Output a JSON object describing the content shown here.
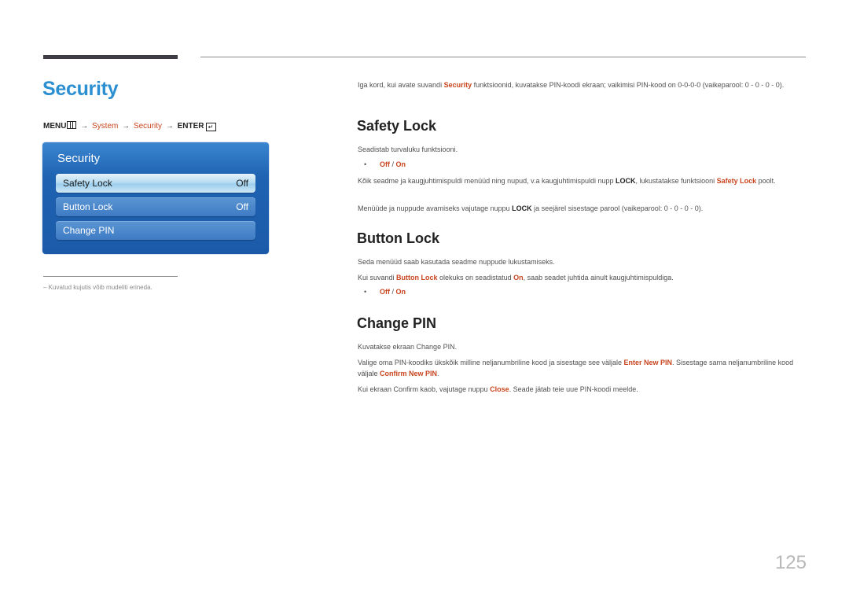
{
  "page": {
    "title": "Security",
    "page_number": "125",
    "footnote": "–  Kuvatud kujutis võib mudeliti erineda."
  },
  "menu_path": {
    "menu": "MENU",
    "arrow": "→",
    "system": "System",
    "security": "Security",
    "enter": "ENTER",
    "enter_glyph": "↵"
  },
  "osd": {
    "title": "Security",
    "items": [
      {
        "label": "Safety Lock",
        "value": "Off",
        "selected": true
      },
      {
        "label": "Button Lock",
        "value": "Off",
        "selected": false
      },
      {
        "label": "Change PIN",
        "value": "",
        "selected": false
      }
    ]
  },
  "intro": {
    "t1": "Iga kord, kui avate suvandi ",
    "hl1": "Security",
    "t2": " funktsioonid, kuvatakse PIN-koodi ekraan; vaikimisi PIN-kood on 0-0-0-0 (vaikeparool: 0 - 0 - 0 - 0)."
  },
  "sections": {
    "safety_lock": {
      "heading": "Safety Lock",
      "desc": "Seadistab turvaluku funktsiooni.",
      "option_off": "Off",
      "option_sep": " / ",
      "option_on": "On",
      "p1_t1": "Kõik seadme ja kaugjuhtimispuldi menüüd ning nupud, v.a kaugjuhtimispuldi nupp ",
      "p1_b1": "LOCK",
      "p1_t2": ", lukustatakse funktsiooni ",
      "p1_hl1": "Safety Lock",
      "p1_t3": " poolt.",
      "p2_t1": "Menüüde ja nuppude avamiseks vajutage nuppu ",
      "p2_b1": "LOCK",
      "p2_t2": " ja seejärel sisestage parool (vaikeparool: 0 - 0 - 0 - 0)."
    },
    "button_lock": {
      "heading": "Button Lock",
      "desc": "Seda menüüd saab kasutada seadme nuppude lukustamiseks.",
      "p1_t1": "Kui suvandi ",
      "p1_hl1": "Button Lock",
      "p1_t2": " olekuks on seadistatud ",
      "p1_hl2": "On",
      "p1_t3": ", saab seadet juhtida ainult kaugjuhtimispuldiga.",
      "option_off": "Off",
      "option_sep": " / ",
      "option_on": "On"
    },
    "change_pin": {
      "heading": "Change PIN",
      "desc": "Kuvatakse ekraan Change PIN.",
      "p1_t1": "Valige oma PIN-koodiks ükskõik milline neljanumbriline kood ja sisestage see väljale ",
      "p1_hl1": "Enter New PIN",
      "p1_t2": ". Sisestage sama neljanumbriline kood väljale ",
      "p1_hl2": "Confirm New PIN",
      "p1_t3": ".",
      "p2_t1": "Kui ekraan Confirm kaob, vajutage nuppu ",
      "p2_hl1": "Close",
      "p2_t2": ". Seade jätab teie uue PIN-koodi meelde."
    }
  },
  "colors": {
    "title_blue": "#2b8fd1",
    "highlight_orange": "#c8451f",
    "osd_blue": "#1f63b3"
  }
}
